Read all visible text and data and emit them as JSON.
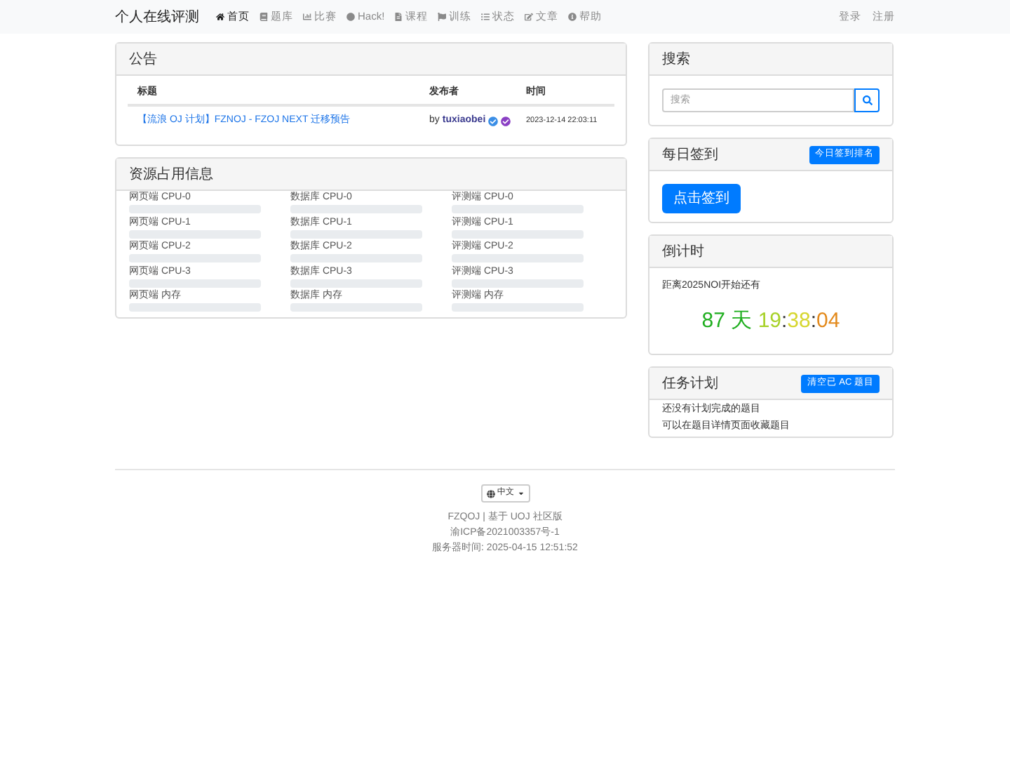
{
  "navbar": {
    "brand": "个人在线评测",
    "items": [
      {
        "label": "首页",
        "selected": true
      },
      {
        "label": "题库",
        "selected": false
      },
      {
        "label": "比赛",
        "selected": false
      },
      {
        "label": "Hack!",
        "selected": false
      },
      {
        "label": "课程",
        "selected": false
      },
      {
        "label": "训练",
        "selected": false
      },
      {
        "label": "状态",
        "selected": false
      },
      {
        "label": "文章",
        "selected": false
      },
      {
        "label": "帮助",
        "selected": false
      }
    ],
    "right_links": [
      "登录",
      "注册"
    ]
  },
  "announcements": {
    "title": "公告",
    "columns": [
      "标题",
      "发布者",
      "时间"
    ],
    "rows": [
      {
        "title": "【流浪 OJ 计划】FZNOJ - FZOJ NEXT 迁移预告",
        "by": "by",
        "author": "tuxiaobei",
        "time": "2023-12-14 22:03:11"
      }
    ]
  },
  "resources": {
    "title": "资源占用信息",
    "items": [
      {
        "label": "网页端 CPU-0",
        "level": 0
      },
      {
        "label": "数据库 CPU-0",
        "level": 0
      },
      {
        "label": "评测端 CPU-0",
        "level": 0
      },
      {
        "label": "网页端 CPU-1",
        "level": 0
      },
      {
        "label": "数据库 CPU-1",
        "level": 0
      },
      {
        "label": "评测端 CPU-1",
        "level": 0
      },
      {
        "label": "网页端 CPU-2",
        "level": 0
      },
      {
        "label": "数据库 CPU-2",
        "level": 0
      },
      {
        "label": "评测端 CPU-2",
        "level": 0
      },
      {
        "label": "网页端 CPU-3",
        "level": 0
      },
      {
        "label": "数据库 CPU-3",
        "level": 0
      },
      {
        "label": "评测端 CPU-3",
        "level": 0
      },
      {
        "label": "网页端 内存",
        "level": 0
      },
      {
        "label": "数据库 内存",
        "level": 0
      },
      {
        "label": "评测端 内存",
        "level": 0
      }
    ]
  },
  "search": {
    "title": "搜索",
    "placeholder": "搜索"
  },
  "checkin": {
    "title": "每日签到",
    "ranking_button": "今日签到排名",
    "checkin_button": "点击签到"
  },
  "countdown": {
    "title": "倒计时",
    "caption": "距离2025NOI开始还有",
    "parts": [
      {
        "text": "87 天 ",
        "color": "#1fae1f"
      },
      {
        "text": "19",
        "color": "#a8d22a"
      },
      {
        "text": ":",
        "color": "#333333"
      },
      {
        "text": "38",
        "color": "#d6d62e"
      },
      {
        "text": ":",
        "color": "#333333"
      },
      {
        "text": "04",
        "color": "#e38a1c"
      }
    ]
  },
  "tasks": {
    "title": "任务计划",
    "clear_button": "清空已 AC 题目",
    "lines": [
      "还没有计划完成的题目",
      "可以在题目详情页面收藏题目"
    ]
  },
  "footer": {
    "language": "中文",
    "lines": [
      "FZQOJ | 基于 UOJ 社区版",
      "渝ICP备2021003357号-1",
      "服务器时间: 2025-04-15 12:51:52"
    ]
  }
}
